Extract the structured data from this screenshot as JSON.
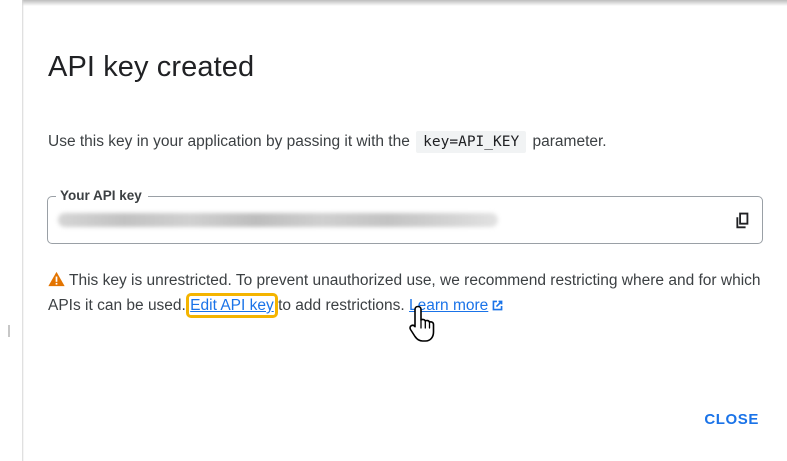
{
  "dialog": {
    "title": "API key created",
    "description_before": "Use this key in your application by passing it with the",
    "code_snippet": "key=API_KEY",
    "description_after": "parameter.",
    "field_label": "Your API key",
    "warning_text_1": "This key is unrestricted. To prevent unauthorized use, we recommend restricting where and for which APIs it can be used.",
    "edit_link": "Edit API key",
    "warning_text_2": "to add restrictions.",
    "learn_more": "Learn more",
    "close_label": "CLOSE"
  },
  "icons": {
    "copy": "copy-icon",
    "warning": "warning-icon",
    "external": "open-in-new-icon",
    "cursor": "hand-pointer-cursor"
  },
  "colors": {
    "link": "#1a73e8",
    "warning": "#e37400",
    "highlight": "#f4b400"
  }
}
